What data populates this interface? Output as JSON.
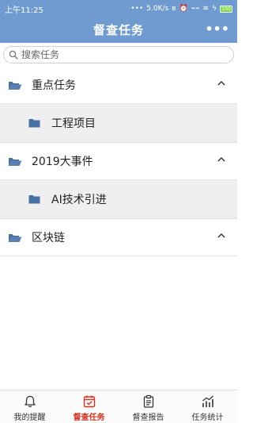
{
  "status_bar": {
    "time": "上午11:25",
    "net_speed": "5.0K/s",
    "battery": "100"
  },
  "header": {
    "title": "督查任务",
    "more_label": "•••"
  },
  "search": {
    "placeholder": "搜索任务"
  },
  "groups": [
    {
      "label": "重点任务",
      "expanded": true,
      "children": [
        {
          "label": "工程项目"
        }
      ]
    },
    {
      "label": "2019大事件",
      "expanded": true,
      "children": [
        {
          "label": "AI技术引进"
        }
      ]
    },
    {
      "label": "区块链",
      "expanded": true,
      "children": []
    }
  ],
  "tabs": [
    {
      "label": "我的提醒",
      "icon": "bell-icon",
      "active": false
    },
    {
      "label": "督查任务",
      "icon": "task-calendar-icon",
      "active": true
    },
    {
      "label": "督查报告",
      "icon": "clipboard-icon",
      "active": false
    },
    {
      "label": "任务统计",
      "icon": "chart-icon",
      "active": false
    }
  ],
  "colors": {
    "header": "#6f9bd0",
    "folder": "#4a6fa3",
    "active_tab": "#d8321e"
  }
}
